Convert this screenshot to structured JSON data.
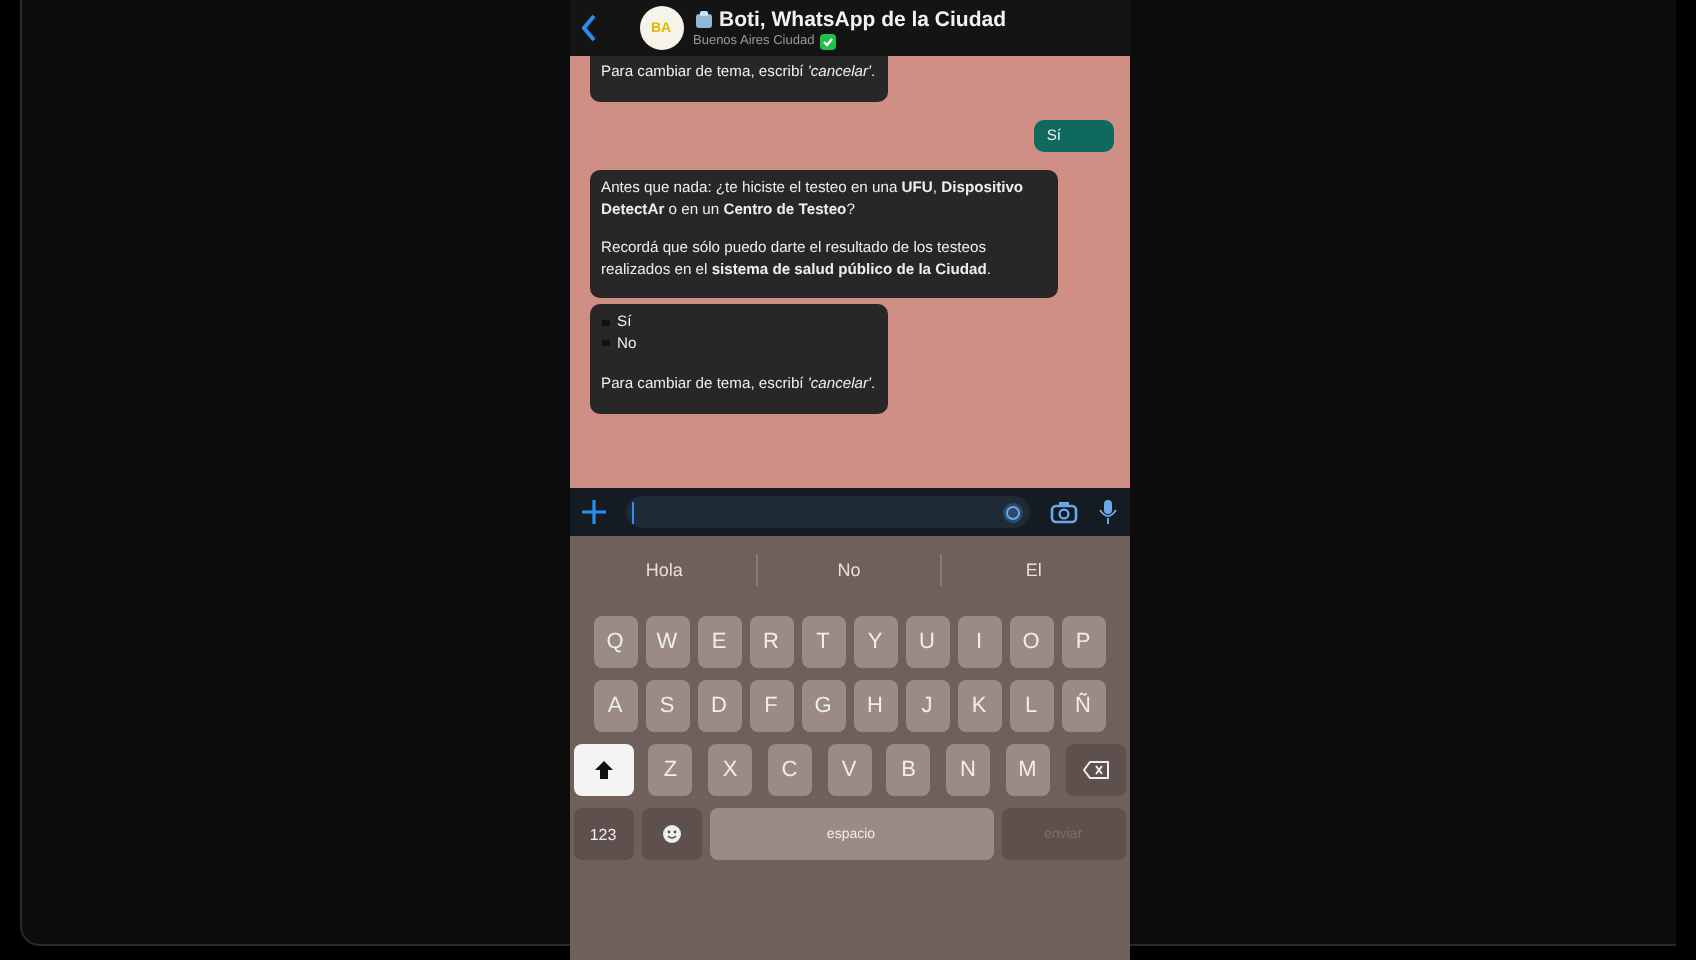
{
  "header": {
    "avatar_text": "BA",
    "title": "Boti, WhatsApp de la Ciudad",
    "subtitle": "Buenos Aires Ciudad",
    "verified": true
  },
  "messages": [
    {
      "outgoing": false,
      "kind": "text",
      "paragraphs": [
        "Para cambiar de tema, escribí *'cancelar'*."
      ]
    },
    {
      "outgoing": true,
      "kind": "text",
      "paragraphs": [
        "Sí"
      ]
    },
    {
      "outgoing": false,
      "kind": "text",
      "paragraphs": [
        "Antes que nada: ¿te hiciste el testeo en una **UFU**, **Dispositivo DetectAr** o en un **Centro de Testeo**?",
        "Recordá que sólo puedo darte el resultado de los testeos realizados en el **sistema de salud público de la Ciudad**."
      ]
    },
    {
      "outgoing": false,
      "kind": "list",
      "items": [
        "Sí",
        "No"
      ],
      "paragraphs": [
        "Para cambiar de tema, escribí *'cancelar'*."
      ]
    }
  ],
  "keyboard": {
    "suggestions": [
      "Hola",
      "No",
      "El"
    ],
    "rows": [
      {
        "keys": [
          "Q",
          "W",
          "E",
          "R",
          "T",
          "Y",
          "U",
          "I",
          "O",
          "P"
        ]
      },
      {
        "keys": [
          "A",
          "S",
          "D",
          "F",
          "G",
          "H",
          "J",
          "K",
          "L",
          "Ñ"
        ]
      },
      {
        "keys": [
          {
            "kind": "shift",
            "on": true
          },
          "Z",
          "X",
          "C",
          "V",
          "B",
          "N",
          "M",
          {
            "kind": "backspace"
          }
        ]
      }
    ],
    "bottom": [
      {
        "kind": "numbers",
        "label": "123"
      },
      {
        "kind": "emoji"
      },
      {
        "kind": "space",
        "label": "espacio"
      },
      {
        "kind": "send",
        "label": "enviar",
        "disabled": true
      }
    ]
  }
}
